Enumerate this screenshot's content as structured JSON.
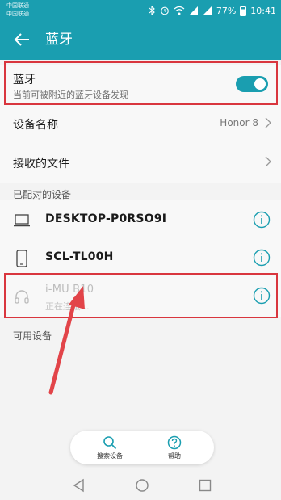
{
  "status_bar": {
    "carrier_1": "中国联通",
    "carrier_2": "中国联通",
    "battery": "77%",
    "time": "10:41"
  },
  "header": {
    "title": "蓝牙",
    "back_icon": "arrow-left-icon"
  },
  "bluetooth": {
    "label": "蓝牙",
    "description": "当前可被附近的蓝牙设备发现",
    "enabled": true,
    "accent_color": "#1a9eb0"
  },
  "settings": {
    "device_name_label": "设备名称",
    "device_name_value": "Honor 8",
    "received_files_label": "接收的文件"
  },
  "paired": {
    "heading": "已配对的设备",
    "devices": [
      {
        "name": "DESKTOP-P0RSO9I",
        "icon": "laptop-icon"
      },
      {
        "name": "SCL-TL00H",
        "icon": "phone-icon"
      },
      {
        "name": "i-MU B10",
        "status": "正在连接...",
        "icon": "headphones-icon"
      }
    ]
  },
  "available": {
    "heading": "可用设备"
  },
  "actions": {
    "search_label": "搜索设备",
    "help_label": "帮助"
  },
  "annotation_color": "#d9363e"
}
